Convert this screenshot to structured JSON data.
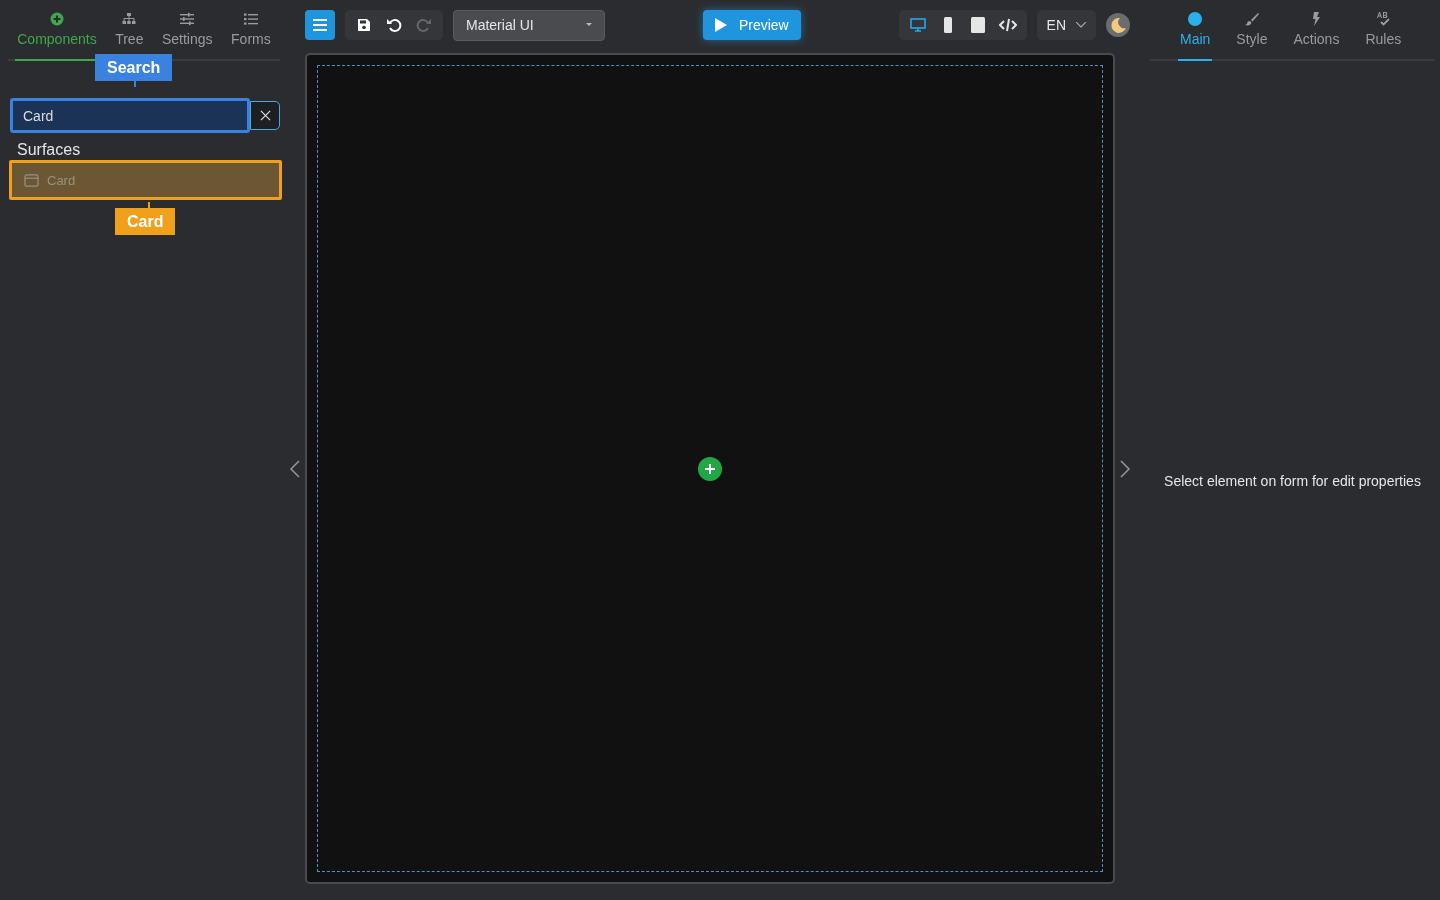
{
  "left_tabs": [
    {
      "kind": "components",
      "label": "Components",
      "selected": true
    },
    {
      "kind": "tree",
      "label": "Tree",
      "selected": false
    },
    {
      "kind": "settings",
      "label": "Settings",
      "selected": false
    },
    {
      "kind": "forms",
      "label": "Forms",
      "selected": false
    }
  ],
  "search": {
    "value": "Card",
    "tooltip": "Search"
  },
  "groups": [
    {
      "title": "Surfaces",
      "items": [
        {
          "label": "Card",
          "highlighted": true,
          "tooltip": "Card"
        }
      ]
    }
  ],
  "toolbar": {
    "template": "Material UI",
    "preview": "Preview",
    "devices": [
      {
        "kind": "desktop",
        "selected": true
      },
      {
        "kind": "phone",
        "selected": false
      },
      {
        "kind": "tablet",
        "selected": false
      },
      {
        "kind": "code",
        "selected": false
      }
    ],
    "language": "EN"
  },
  "right_tabs": [
    {
      "kind": "main",
      "label": "Main",
      "selected": true
    },
    {
      "kind": "style",
      "label": "Style",
      "selected": false
    },
    {
      "kind": "actions",
      "label": "Actions",
      "selected": false
    },
    {
      "kind": "rules",
      "label": "Rules",
      "selected": false
    }
  ],
  "properties_message": "Select element on form for edit properties"
}
